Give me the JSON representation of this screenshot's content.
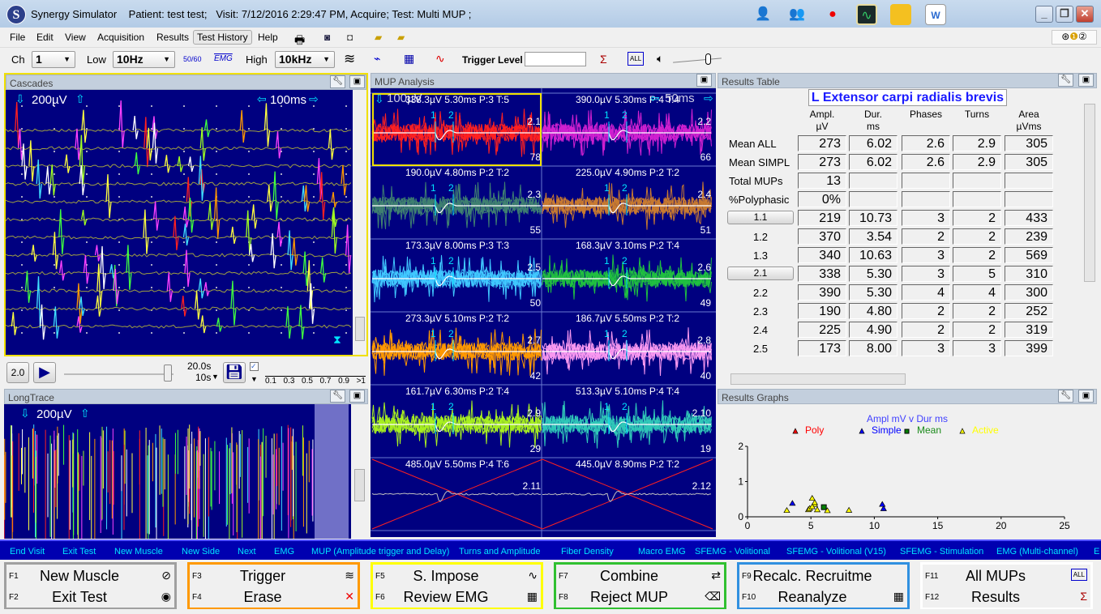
{
  "window": {
    "app": "Synergy Simulator",
    "title": "Synergy Simulator    Patient: test test;   Visit: 7/12/2016 2:29:47 PM, Acquire; Test: Multi MUP ;",
    "logo_letter": "S",
    "title_icons": [
      "add-patient-icon",
      "patient-import-icon",
      "record-icon",
      "monitor-icon",
      "folder-icon",
      "word-report-icon"
    ]
  },
  "menu": [
    "File",
    "Edit",
    "View",
    "Acquisition",
    "Results",
    "Test History",
    "Help"
  ],
  "toolbar": {
    "ch_label": "Ch",
    "ch_value": "1",
    "low_label": "Low",
    "low_value": "10Hz",
    "high_label": "High",
    "high_value": "10kHz",
    "notch_label": "50/60",
    "emg_label": "EMG",
    "trigger_label": "Trigger Level",
    "trigger_value": "",
    "all_label": "ALL",
    "sigma": "Σ"
  },
  "cascades": {
    "title": "Cascades",
    "gain": "200µV",
    "timebase": "100ms"
  },
  "controls": {
    "speed": "2.0",
    "time": "20.0s",
    "span": "10s",
    "scale": [
      "0.1",
      "0.3",
      "0.5",
      "0.7",
      "0.9",
      ">1"
    ],
    "checked": true
  },
  "longtrace": {
    "title": "LongTrace",
    "gain": "200µV"
  },
  "mup": {
    "title": "MUP Analysis",
    "gain": "100µV",
    "timebase": "50ms",
    "cells": [
      {
        "label": "338.3µV 5.30ms P:3 T:5",
        "id": "2.1",
        "count": "78",
        "color": "#ff2020"
      },
      {
        "label": "390.0µV 5.30ms P:4 T:4",
        "id": "2.2",
        "count": "66",
        "color": "#d020d0"
      },
      {
        "label": "190.0µV 4.80ms P:2 T:2",
        "id": "2.3",
        "count": "55",
        "color": "#3f8070"
      },
      {
        "label": "225.0µV 4.90ms P:2 T:2",
        "id": "2.4",
        "count": "51",
        "color": "#c87a30"
      },
      {
        "label": "173.3µV 8.00ms P:3 T:3",
        "id": "2.5",
        "count": "50",
        "color": "#40c8ff"
      },
      {
        "label": "168.3µV 3.10ms P:2 T:4",
        "id": "2.6",
        "count": "49",
        "color": "#20c040"
      },
      {
        "label": "273.3µV 5.10ms P:2 T:2",
        "id": "2.7",
        "count": "42",
        "color": "#ff9900"
      },
      {
        "label": "186.7µV 5.50ms P:2 T:2",
        "id": "2.8",
        "count": "40",
        "color": "#f898f0"
      },
      {
        "label": "161.7µV 6.30ms P:2 T:4",
        "id": "2.9",
        "count": "29",
        "color": "#a8f020"
      },
      {
        "label": "513.3µV 5.10ms P:4 T:4",
        "id": "2.10",
        "count": "19",
        "color": "#30c8b8"
      },
      {
        "label": "485.0µV 5.50ms P:4 T:6",
        "id": "2.11",
        "count": "",
        "color": ""
      },
      {
        "label": "445.0µV 8.90ms P:2 T:2",
        "id": "2.12",
        "count": "",
        "color": ""
      }
    ]
  },
  "results": {
    "title": "Results Table",
    "muscle": "L Extensor carpi radialis brevis",
    "headers": [
      [
        "Ampl.",
        "µV"
      ],
      [
        "Dur.",
        "ms"
      ],
      [
        "Phases",
        ""
      ],
      [
        "Turns",
        ""
      ],
      [
        "Area",
        "µVms"
      ]
    ],
    "rows": [
      {
        "label": "Mean ALL",
        "button": false,
        "v": [
          "273",
          "6.02",
          "2.6",
          "2.9",
          "305"
        ]
      },
      {
        "label": "Mean SIMPL",
        "button": false,
        "v": [
          "273",
          "6.02",
          "2.6",
          "2.9",
          "305"
        ]
      },
      {
        "label": "Total MUPs",
        "button": false,
        "v": [
          "13",
          "",
          "",
          "",
          ""
        ]
      },
      {
        "label": "%Polyphasic",
        "button": false,
        "v": [
          "0%",
          "",
          "",
          "",
          ""
        ]
      },
      {
        "label": "1.1",
        "button": true,
        "v": [
          "219",
          "10.73",
          "3",
          "2",
          "433"
        ]
      },
      {
        "label": "1.2",
        "button": false,
        "v": [
          "370",
          "3.54",
          "2",
          "2",
          "239"
        ]
      },
      {
        "label": "1.3",
        "button": false,
        "v": [
          "340",
          "10.63",
          "3",
          "2",
          "569"
        ]
      },
      {
        "label": "2.1",
        "button": true,
        "v": [
          "338",
          "5.30",
          "3",
          "5",
          "310"
        ]
      },
      {
        "label": "2.2",
        "button": false,
        "v": [
          "390",
          "5.30",
          "4",
          "4",
          "300"
        ]
      },
      {
        "label": "2.3",
        "button": false,
        "v": [
          "190",
          "4.80",
          "2",
          "2",
          "252"
        ]
      },
      {
        "label": "2.4",
        "button": false,
        "v": [
          "225",
          "4.90",
          "2",
          "2",
          "319"
        ]
      },
      {
        "label": "2.5",
        "button": false,
        "v": [
          "173",
          "8.00",
          "3",
          "3",
          "399"
        ]
      }
    ]
  },
  "graphs": {
    "title": "Results Graphs"
  },
  "chart_data": {
    "type": "scatter",
    "title": "Ampl mV v Dur ms",
    "xlim": [
      0,
      25
    ],
    "ylim": [
      0,
      2
    ],
    "xticks": [
      "0",
      "5",
      "10",
      "15",
      "20",
      "25"
    ],
    "yticks": [
      "0",
      "1",
      "2"
    ],
    "legend_placement": "top",
    "series": [
      {
        "name": "Poly",
        "color": "#ff0000",
        "marker": "triangle",
        "points": []
      },
      {
        "name": "Simple",
        "color": "#0000ff",
        "marker": "triangle",
        "points": [
          [
            10.73,
            0.219
          ],
          [
            3.54,
            0.37
          ],
          [
            10.63,
            0.34
          ]
        ]
      },
      {
        "name": "Mean",
        "color": "#008000",
        "marker": "square",
        "points": [
          [
            6.02,
            0.273
          ]
        ]
      },
      {
        "name": "Active",
        "color": "#ffff00",
        "marker": "triangle",
        "points": [
          [
            5.3,
            0.338
          ],
          [
            5.3,
            0.39
          ],
          [
            4.8,
            0.19
          ],
          [
            4.9,
            0.225
          ],
          [
            8.0,
            0.173
          ],
          [
            3.1,
            0.168
          ],
          [
            5.1,
            0.273
          ],
          [
            5.5,
            0.187
          ],
          [
            6.3,
            0.162
          ],
          [
            5.1,
            0.513
          ]
        ]
      }
    ]
  },
  "tests": [
    "End Visit",
    "Exit Test",
    "New Muscle",
    "New Side",
    "Next",
    "EMG",
    "MUP (Amplitude trigger and Delay)",
    "Turns and Amplitude",
    "Fiber Density",
    "Macro EMG",
    "SFEMG - Volitional",
    "SFEMG - Volitional (V15)",
    "SFEMG - Stimulation",
    "EMG (Multi-channel)",
    "E"
  ],
  "fkeys": [
    {
      "color": "#a0a0a0",
      "b": [
        {
          "k": "F1",
          "n": "New Muscle",
          "i": "⊘"
        },
        {
          "k": "F2",
          "n": "Exit Test",
          "i": "◉"
        }
      ]
    },
    {
      "color": "#ff9900",
      "b": [
        {
          "k": "F3",
          "n": "Trigger",
          "i": "≋"
        },
        {
          "k": "F4",
          "n": "Erase",
          "i": "✕"
        }
      ]
    },
    {
      "color": "#ffff00",
      "b": [
        {
          "k": "F5",
          "n": "S. Impose",
          "i": "∿"
        },
        {
          "k": "F6",
          "n": "Review EMG",
          "i": "▦"
        }
      ]
    },
    {
      "color": "#30c030",
      "b": [
        {
          "k": "F7",
          "n": "Combine",
          "i": "⇄"
        },
        {
          "k": "F8",
          "n": "Reject MUP",
          "i": "⌫"
        }
      ]
    },
    {
      "color": "#3090e0",
      "b": [
        {
          "k": "F9",
          "n": "Recalc. Recruitme",
          "i": ""
        },
        {
          "k": "F10",
          "n": "Reanalyze",
          "i": "▦"
        }
      ]
    },
    {
      "color": "#ffffff",
      "b": [
        {
          "k": "F11",
          "n": "All MUPs",
          "i": "ALL"
        },
        {
          "k": "F12",
          "n": "Results",
          "i": "Σ"
        }
      ]
    }
  ]
}
